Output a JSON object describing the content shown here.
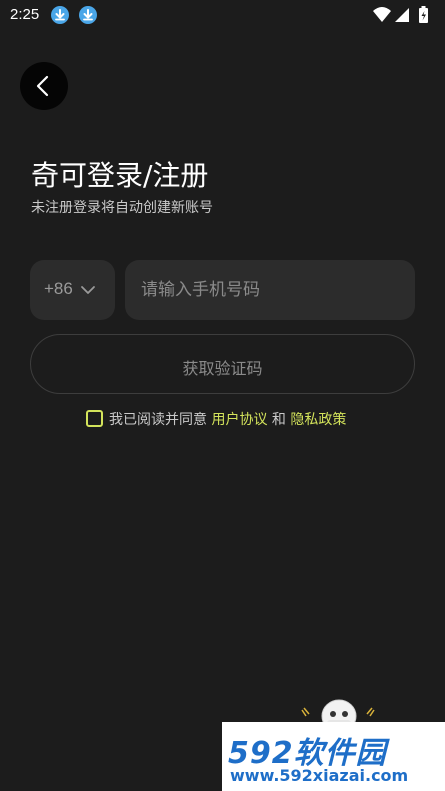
{
  "status_bar": {
    "time": "2:25",
    "icons": [
      "download-icon",
      "download-icon",
      "wifi-icon",
      "signal-icon",
      "battery-charging-icon"
    ]
  },
  "nav": {
    "back_icon": "chevron-left-icon"
  },
  "header": {
    "title": "奇可登录/注册",
    "subtitle": "未注册登录将自动创建新账号"
  },
  "form": {
    "country_code": "+86",
    "phone_placeholder": "请输入手机号码",
    "phone_value": "",
    "get_code_label": "获取验证码"
  },
  "agreement": {
    "checked": false,
    "prefix": "我已阅读并同意 ",
    "user_agreement": "用户协议",
    "and": " 和 ",
    "privacy_policy": "隐私政策"
  },
  "watermark": {
    "brand": "592软件园",
    "url": "www.592xiazai.com"
  },
  "colors": {
    "background": "#1c1c1c",
    "field": "#2c2c2c",
    "accent": "#d3e35b",
    "watermark": "#1e6ec8"
  }
}
